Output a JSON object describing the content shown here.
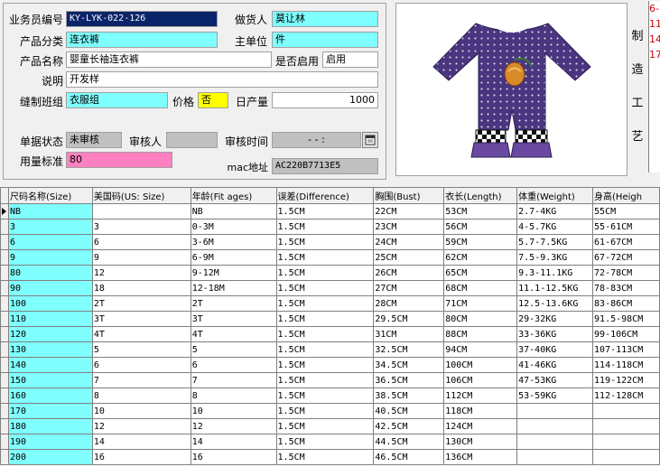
{
  "form": {
    "salesman_no_label": "业务员编号",
    "salesman_no": "KY-LYK-022-126",
    "maker_label": "做货人",
    "maker": "莫让林",
    "category_label": "产品分类",
    "category": "连衣裤",
    "main_unit_label": "主单位",
    "main_unit": "件",
    "product_name_label": "产品名称",
    "product_name": "婴童长袖连衣裤",
    "enabled_label": "是否启用",
    "enabled": "启用",
    "description_label": "说明",
    "description": "开发样",
    "sewing_group_label": "缝制班组",
    "sewing_group": "衣服组",
    "price_label": "价格",
    "price": "否",
    "daily_output_label": "日产量",
    "daily_output": "1000",
    "doc_status_label": "单据状态",
    "doc_status": "未审核",
    "reviewer_label": "审核人",
    "reviewer": "",
    "review_time_label": "审核时间",
    "review_time": "- - :",
    "material_std_label": "用量标准",
    "material_std": "80",
    "mac_label": "mac地址",
    "mac": "AC220B7713E5"
  },
  "process_panel": {
    "label_chars": [
      "制",
      "造",
      "工",
      "艺"
    ],
    "notes_lines": [
      "6-",
      "11",
      "14",
      "17"
    ]
  },
  "grid": {
    "columns": [
      "尺码名称(Size)",
      "美国码(US: Size)",
      "年龄(Fit ages)",
      "误差(Difference)",
      "胸围(Bust)",
      "衣长(Length)",
      "体重(Weight)",
      "身高(Heigh"
    ],
    "rows": [
      [
        "NB",
        "",
        "NB",
        "1.5CM",
        "22CM",
        "53CM",
        "2.7-4KG",
        "55CM"
      ],
      [
        "3",
        "3",
        "0-3M",
        "1.5CM",
        "23CM",
        "56CM",
        "4-5.7KG",
        "55-61CM"
      ],
      [
        "6",
        "6",
        "3-6M",
        "1.5CM",
        "24CM",
        "59CM",
        "5.7-7.5KG",
        "61-67CM"
      ],
      [
        "9",
        "9",
        "6-9M",
        "1.5CM",
        "25CM",
        "62CM",
        "7.5-9.3KG",
        "67-72CM"
      ],
      [
        "80",
        "12",
        "9-12M",
        "1.5CM",
        "26CM",
        "65CM",
        "9.3-11.1KG",
        "72-78CM"
      ],
      [
        "90",
        "18",
        "12-18M",
        "1.5CM",
        "27CM",
        "68CM",
        "11.1-12.5KG",
        "78-83CM"
      ],
      [
        "100",
        "2T",
        "2T",
        "1.5CM",
        "28CM",
        "71CM",
        "12.5-13.6KG",
        "83-86CM"
      ],
      [
        "110",
        "3T",
        "3T",
        "1.5CM",
        "29.5CM",
        "80CM",
        "29-32KG",
        "91.5-98CM"
      ],
      [
        "120",
        "4T",
        "4T",
        "1.5CM",
        "31CM",
        "88CM",
        "33-36KG",
        "99-106CM"
      ],
      [
        "130",
        "5",
        "5",
        "1.5CM",
        "32.5CM",
        "94CM",
        "37-40KG",
        "107-113CM"
      ],
      [
        "140",
        "6",
        "6",
        "1.5CM",
        "34.5CM",
        "100CM",
        "41-46KG",
        "114-118CM"
      ],
      [
        "150",
        "7",
        "7",
        "1.5CM",
        "36.5CM",
        "106CM",
        "47-53KG",
        "119-122CM"
      ],
      [
        "160",
        "8",
        "8",
        "1.5CM",
        "38.5CM",
        "112CM",
        "53-59KG",
        "112-128CM"
      ],
      [
        "170",
        "10",
        "10",
        "1.5CM",
        "40.5CM",
        "118CM",
        "",
        ""
      ],
      [
        "180",
        "12",
        "12",
        "1.5CM",
        "42.5CM",
        "124CM",
        "",
        ""
      ],
      [
        "190",
        "14",
        "14",
        "1.5CM",
        "44.5CM",
        "130CM",
        "",
        ""
      ],
      [
        "200",
        "16",
        "16",
        "1.5CM",
        "46.5CM",
        "136CM",
        "",
        ""
      ]
    ]
  },
  "colors": {
    "cyan_field": "#80ffff",
    "pink_field": "#ff80c0",
    "yellow_field": "#ffff00",
    "notes_text": "#cc0000"
  }
}
